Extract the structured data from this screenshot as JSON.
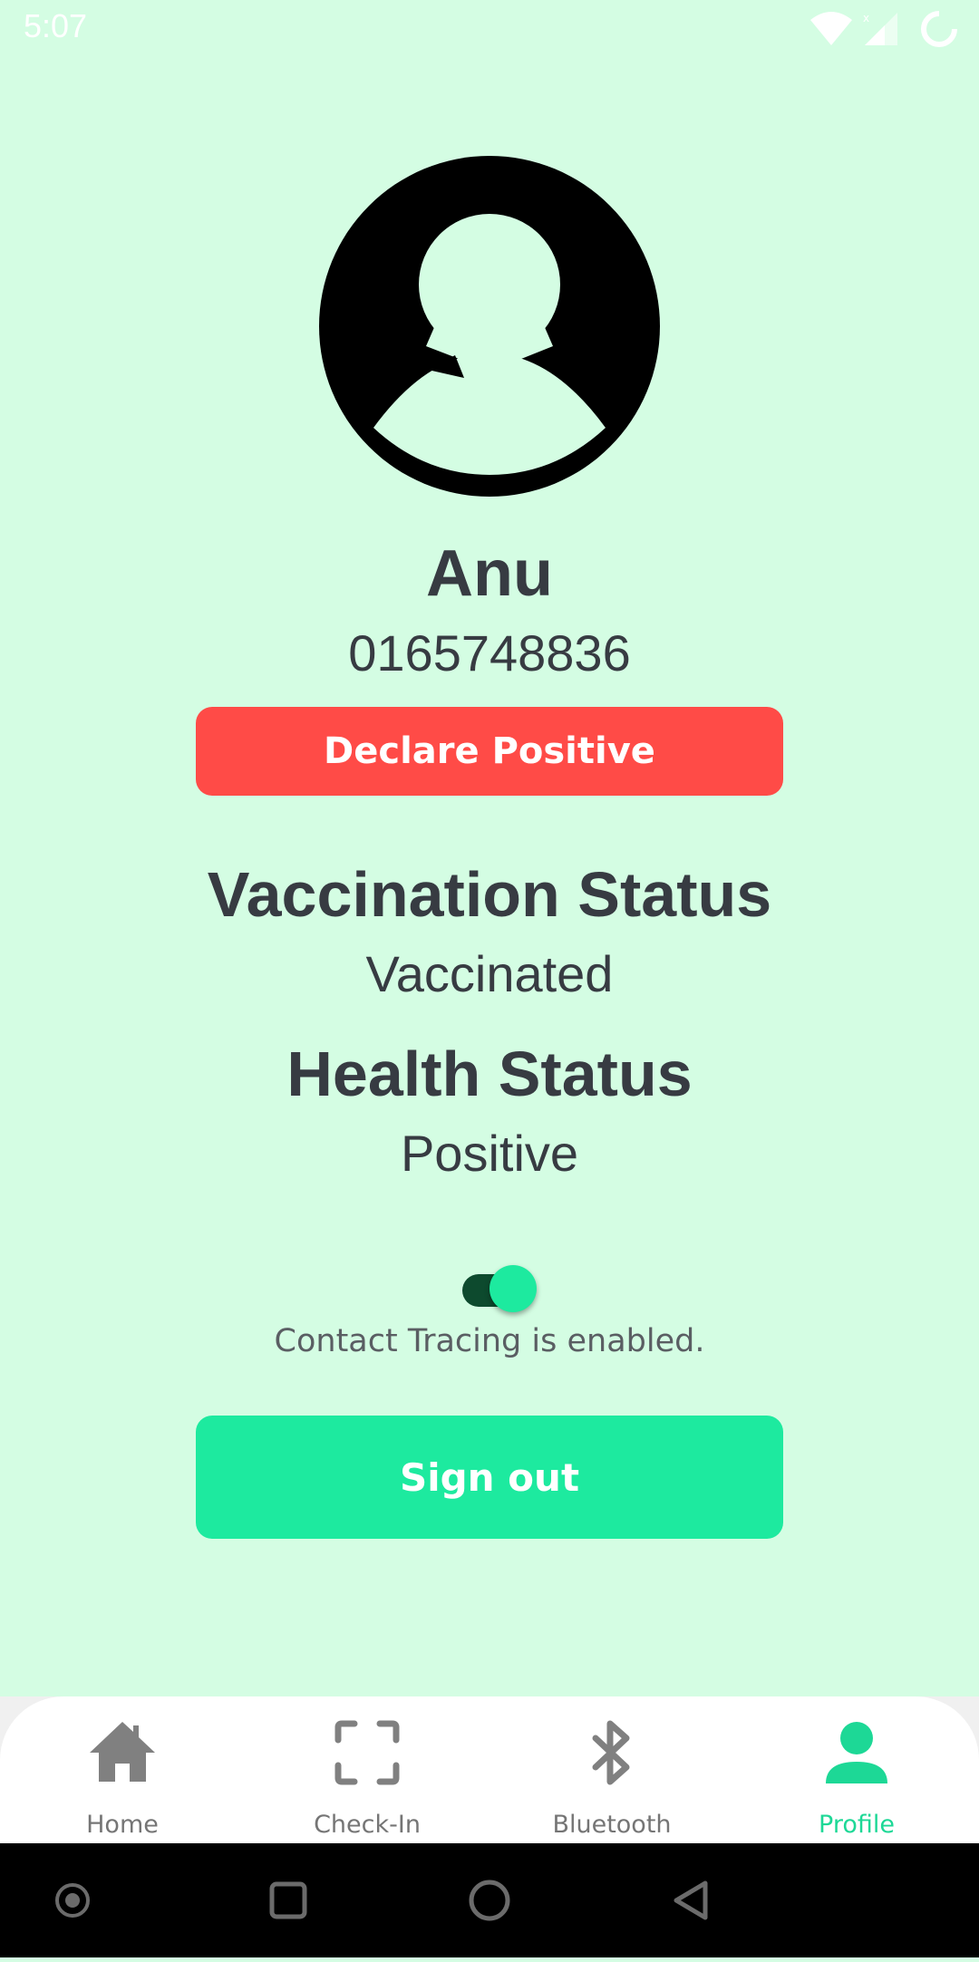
{
  "status_bar": {
    "time": "5:07",
    "icons": [
      "wifi-icon",
      "cell-signal-icon",
      "loading-icon"
    ]
  },
  "profile": {
    "name": "Anu",
    "phone": "0165748836",
    "avatar_icon": "person-avatar-icon"
  },
  "actions": {
    "declare_label": "Declare Positive",
    "signout_label": "Sign out"
  },
  "vaccination": {
    "title": "Vaccination Status",
    "value": "Vaccinated"
  },
  "health": {
    "title": "Health Status",
    "value": "Positive"
  },
  "contact_tracing": {
    "enabled": true,
    "label": "Contact Tracing is enabled."
  },
  "bottom_nav": {
    "active": "Profile",
    "items": [
      {
        "label": "Home",
        "icon": "home-icon"
      },
      {
        "label": "Check-In",
        "icon": "scan-frame-icon"
      },
      {
        "label": "Bluetooth",
        "icon": "bluetooth-icon"
      },
      {
        "label": "Profile",
        "icon": "person-icon"
      }
    ]
  },
  "system_nav": {
    "items": [
      "dot-button-icon",
      "recents-square-icon",
      "home-circle-icon",
      "back-triangle-icon"
    ]
  },
  "colors": {
    "background": "#d4fde3",
    "declare": "#ff4b47",
    "accent": "#1dea9f",
    "text": "#373b42"
  }
}
